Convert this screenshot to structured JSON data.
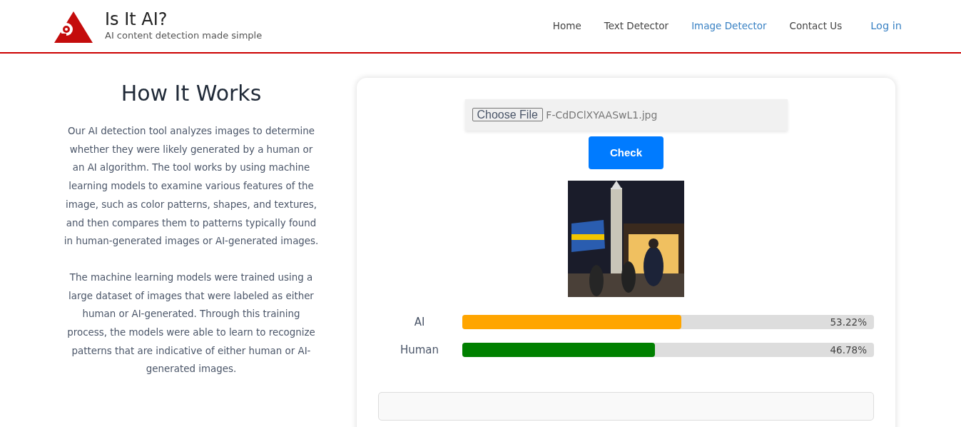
{
  "brand": {
    "title": "Is It AI?",
    "tagline": "AI content detection made simple"
  },
  "nav": [
    {
      "label": "Home",
      "selected": false
    },
    {
      "label": "Text Detector",
      "selected": false
    },
    {
      "label": "Image Detector",
      "selected": true
    },
    {
      "label": "Contact Us",
      "selected": false
    }
  ],
  "login": "Log in",
  "how_it_works": {
    "heading": "How It Works",
    "paragraphs": [
      "Our AI detection tool analyzes images to determine whether they were likely generated by a human or an AI algorithm. The tool works by using machine learning models to examine various features of the image, such as color patterns, shapes, and textures, and then compares them to patterns typically found in human-generated images or AI-generated images.",
      "The machine learning models were trained using a large dataset of images that were labeled as either human or AI-generated. Through this training process, the models were able to learn to recognize patterns that are indicative of either human or AI-generated images."
    ]
  },
  "upload": {
    "button": "Choose File",
    "file_name": "F-CdDClXYAASwL1.jpg"
  },
  "check_button": "Check",
  "results": [
    {
      "label": "AI",
      "level": 0.5322,
      "reading": "53.22%",
      "color": "#ffa500"
    },
    {
      "label": "Human",
      "level": 0.4678,
      "reading": "46.78%",
      "color": "#008000"
    }
  ]
}
